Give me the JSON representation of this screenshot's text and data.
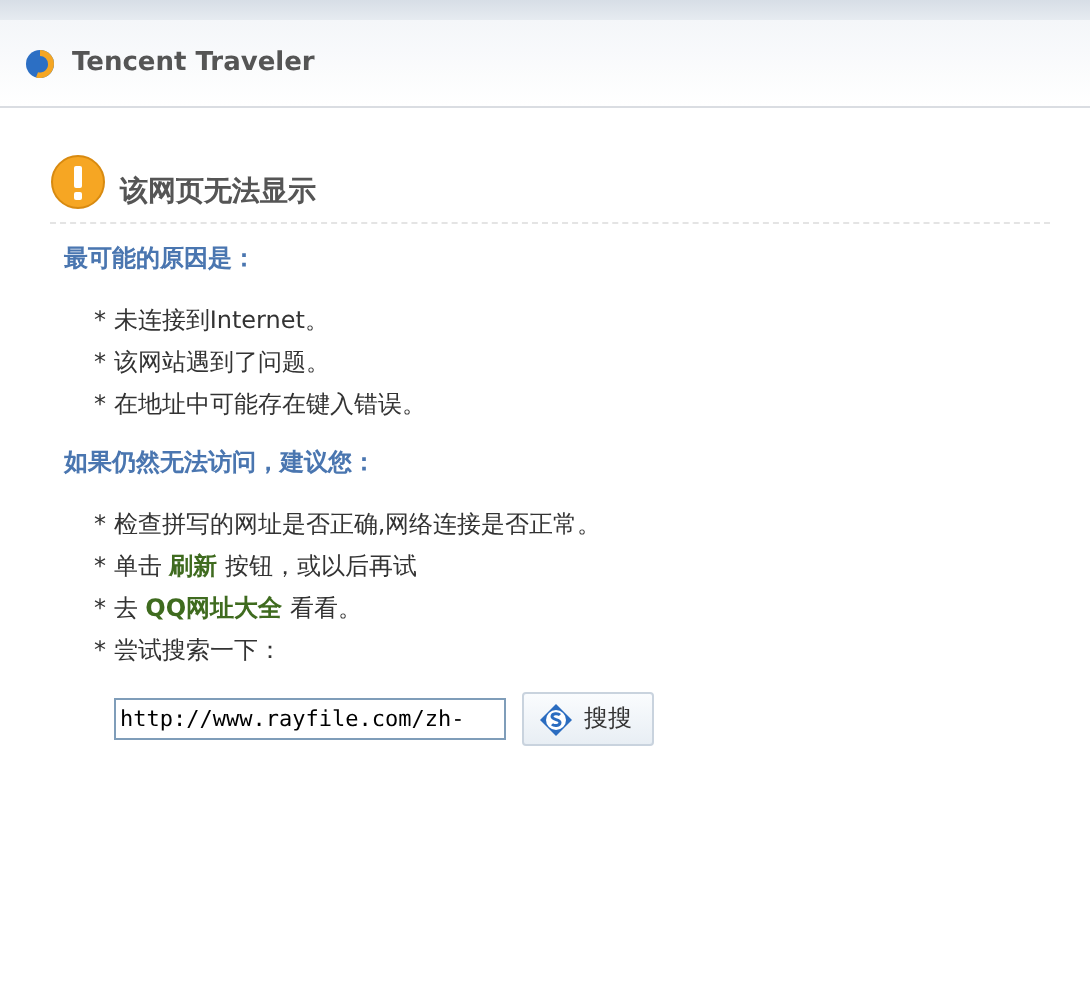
{
  "header": {
    "title": "Tencent Traveler"
  },
  "error": {
    "title": "该网页无法显示"
  },
  "reasons": {
    "heading": "最可能的原因是：",
    "items": [
      "* 未连接到Internet。",
      "* 该网站遇到了问题。",
      "* 在地址中可能存在键入错误。"
    ]
  },
  "suggestions": {
    "heading": "如果仍然无法访问，建议您：",
    "items": [
      [
        {
          "kind": "text",
          "text": "* 检查拼写的网址是否正确,网络连接是否正常。"
        }
      ],
      [
        {
          "kind": "text",
          "text": "* 单击 "
        },
        {
          "kind": "link",
          "text": "刷新"
        },
        {
          "kind": "text",
          "text": " 按钮，或以后再试"
        }
      ],
      [
        {
          "kind": "text",
          "text": "* 去 "
        },
        {
          "kind": "link",
          "text": "QQ网址大全"
        },
        {
          "kind": "text",
          "text": " 看看。"
        }
      ],
      [
        {
          "kind": "text",
          "text": "* 尝试搜索一下："
        }
      ]
    ]
  },
  "search": {
    "value": "http://www.rayfile.com/zh-",
    "button": "搜搜"
  }
}
